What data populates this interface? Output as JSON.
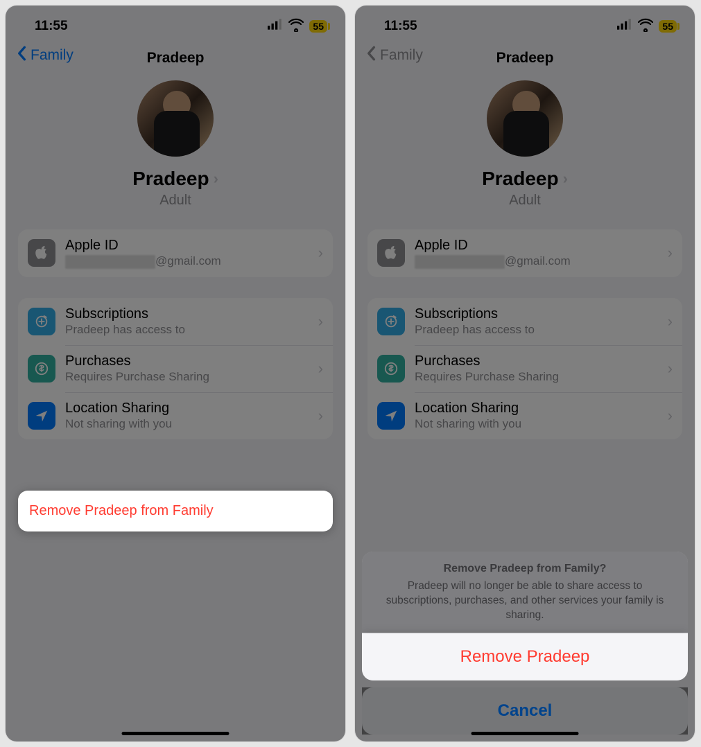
{
  "status": {
    "time": "11:55",
    "battery": "55"
  },
  "nav": {
    "back": "Family",
    "title": "Pradeep"
  },
  "profile": {
    "name": "Pradeep",
    "role": "Adult"
  },
  "appleid": {
    "label": "Apple ID",
    "domain": "@gmail.com"
  },
  "rows": {
    "subscriptions": {
      "title": "Subscriptions",
      "sub": "Pradeep has access to"
    },
    "purchases": {
      "title": "Purchases",
      "sub": "Requires Purchase Sharing"
    },
    "location": {
      "title": "Location Sharing",
      "sub": "Not sharing with you"
    }
  },
  "remove": {
    "label": "Remove Pradeep from Family"
  },
  "sheet": {
    "title": "Remove Pradeep from Family?",
    "message": "Pradeep will no longer be able to share access to subscriptions, purchases, and other services your family is sharing.",
    "confirm": "Remove Pradeep",
    "cancel": "Cancel"
  }
}
